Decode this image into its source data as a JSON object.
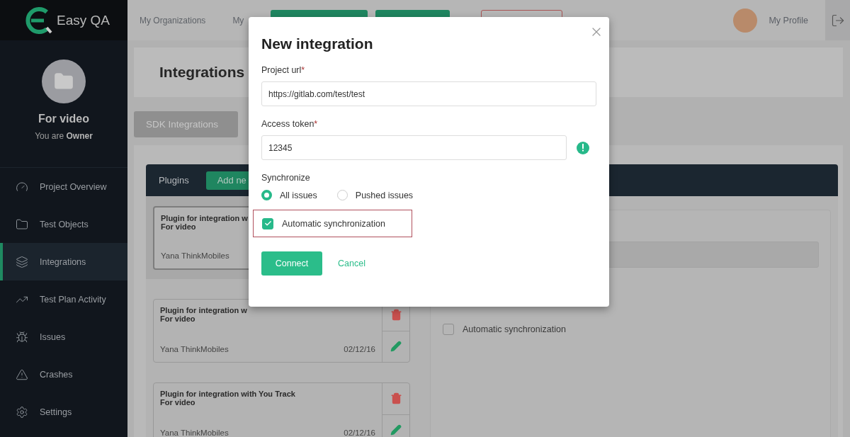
{
  "logo": {
    "text": "Easy QA"
  },
  "project": {
    "name": "For video",
    "role_prefix": "You are",
    "role": "Owner"
  },
  "nav": [
    {
      "label": "Project Overview",
      "selected": false
    },
    {
      "label": "Test Objects",
      "selected": false
    },
    {
      "label": "Integrations",
      "selected": true
    },
    {
      "label": "Test Plan Activity",
      "selected": false
    },
    {
      "label": "Issues",
      "selected": false
    },
    {
      "label": "Crashes",
      "selected": false
    },
    {
      "label": "Settings",
      "selected": false
    }
  ],
  "top_nav": [
    {
      "label": "My Organizations"
    },
    {
      "label": "My"
    }
  ],
  "header_buttons": [
    {
      "kind": "primary"
    },
    {
      "kind": "primary"
    },
    {
      "kind": "danger"
    }
  ],
  "profile": {
    "label": "My Profile"
  },
  "page_title": "Integrations",
  "sdk_button": "SDK Integrations",
  "plugins": {
    "title": "Plugins",
    "add_button": "Add ne",
    "items": [
      {
        "title": "Plugin for integration w",
        "project": "For video",
        "author": "Yana ThinkMobiles",
        "selected": true
      },
      {
        "title": "Plugin for integration w",
        "project": "For video",
        "author": "Yana ThinkMobiles",
        "date": "02/12/16",
        "selected": false
      },
      {
        "title": "Plugin for integration with You Track",
        "project": "For video",
        "author": "Yana ThinkMobiles",
        "date": "02/12/16",
        "selected": false
      }
    ]
  },
  "detail": {
    "auto_sync": {
      "label": "Automatic synchronization",
      "checked": false
    }
  },
  "modal": {
    "title": "New integration",
    "fields": [
      {
        "label": "Project url",
        "required_mark": "*",
        "value": "https://gitlab.com/test/test",
        "alert": false
      },
      {
        "label": "Access token",
        "required_mark": "*",
        "value": "12345",
        "alert": true
      }
    ],
    "sync_label": "Synchronize",
    "sync_options": [
      {
        "label": "All issues",
        "selected": true
      },
      {
        "label": "Pushed issues",
        "selected": false
      }
    ],
    "auto_sync": {
      "label": "Automatic synchronization",
      "checked": true
    },
    "connect": "Connect",
    "cancel": "Cancel"
  }
}
